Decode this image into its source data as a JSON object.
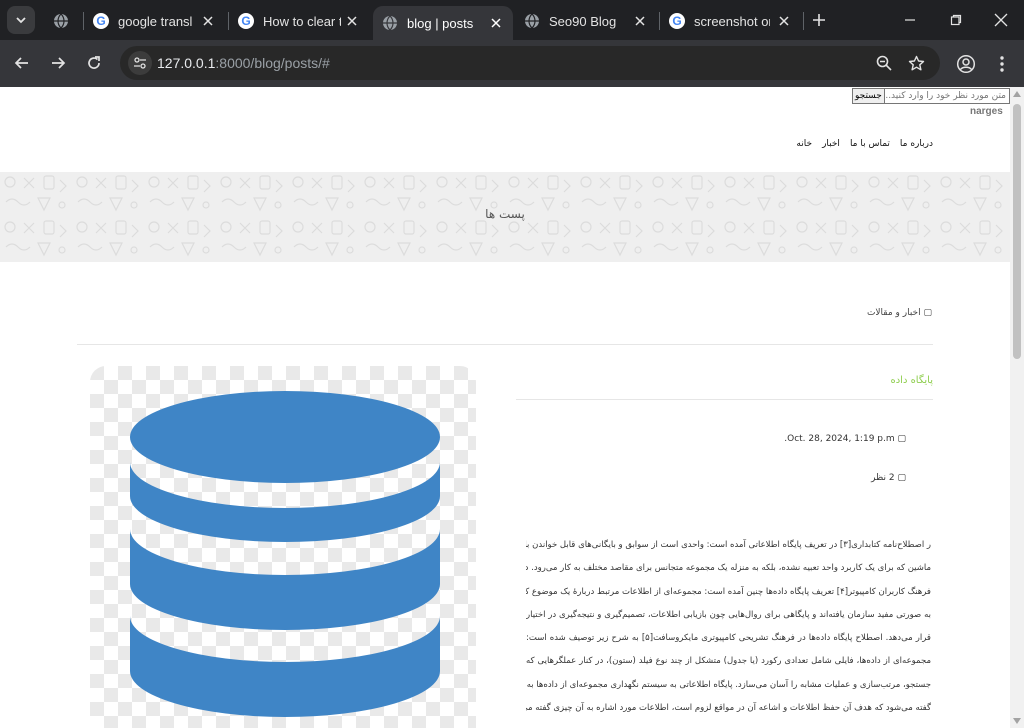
{
  "browser": {
    "tabs": [
      {
        "title": "",
        "icon": "globe-icon",
        "active": false
      },
      {
        "title": "google transl",
        "icon": "google-icon",
        "active": false
      },
      {
        "title": "How to clear t",
        "icon": "google-icon",
        "active": false
      },
      {
        "title": "blog | posts",
        "icon": "globe-icon",
        "active": true
      },
      {
        "title": "Seo90 Blog",
        "icon": "globe-icon",
        "active": false
      },
      {
        "title": "screenshot or",
        "icon": "google-icon",
        "active": false
      }
    ],
    "url_host": "127.0.0.1",
    "url_rest": ":8000/blog/posts/#"
  },
  "page": {
    "search_placeholder": "متن مورد نظر خود را وارد کنید...",
    "search_button": "جستجو",
    "username": "narges",
    "nav": [
      "خانه",
      "اخبار",
      "تماس با ما",
      "درباره ما"
    ],
    "banner_title": "پست ها",
    "breadcrumb": "اخبار و مقالات",
    "post": {
      "title": "پایگاه داده",
      "date": "Oct. 28, 2024, 1:19 p.m.",
      "comments": "2 نظر",
      "body_lines": [
        "ر اصطلاح‌نامه کتابداری[۳] در تعریف پایگاه اطلاعاتی آمده است: واحدی است از سوابق و بایگانی‌های قابل خواندن با",
        "ماشین که برای یک کاربرد واحد تعبیه نشده، بلکه به منزله یک مجموعه متجانس برای مقاصد مختلف به کار می‌رود. در",
        "فرهنگ کاربران کامپیوتر[۴] تعریف پایگاه داده‌ها چنین آمده است: مجموعه‌ای از اطلاعات مرتبط دربارهٔ یک موضوع که",
        "به صورتی مفید سازمان یافته‌اند و پایگاهی برای روال‌هایی چون بازیابی اطلاعات، تصمیم‌گیری و نتیجه‌گیری در اختیار",
        "قرار می‌دهد. اصطلاح پایگاه داده‌ها در فرهنگ تشریحی کامپیوتری مایکروسافت[۵] به شرح زیر توصیف شده است:",
        "مجموعه‌ای از داده‌ها، فایلی شامل تعدادی رکورد (یا جدول) متشکل از چند نوع فیلد (ستون)، در کنار عملگرهایی که",
        "جستجو، مرتب‌سازی و عملیات مشابه را آسان می‌سازد. پایگاه اطلاعاتی به سیستم نگهداری مجموعه‌ای از داده‌ها به هم",
        "گفته می‌شود که هدف آن حفظ اطلاعات و اشاعه آن در مواقع لزوم است، اطلاعات مورد اشاره به آن چیزی گفته می‌شود"
      ]
    }
  },
  "colors": {
    "post_title": "#8fce4f",
    "db_icon": "#3f85c6",
    "banner": "#efefef"
  }
}
